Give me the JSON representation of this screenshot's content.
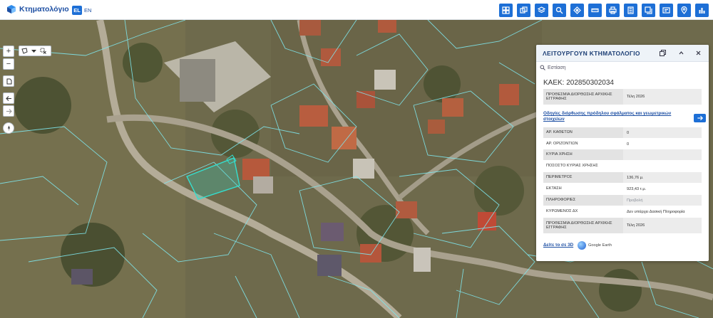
{
  "app": {
    "logo_text": "Κτηματολόγιο",
    "lang_el": "EL",
    "lang_en": "EN"
  },
  "toolbar": {
    "icons": [
      "layout-grid-icon",
      "layers-copy-icon",
      "layers-icon",
      "search-icon",
      "target-icon",
      "ruler-icon",
      "print-icon",
      "calculator-icon",
      "stack-icon",
      "certificate-icon",
      "location-pin-icon",
      "chart-icon"
    ],
    "accent": "#1d6fd6"
  },
  "map_controls": {
    "zoom_in": "+",
    "zoom_out": "−"
  },
  "panel": {
    "title": "ΛΕΙΤΟΥΡΓΟΥΝ ΚΤΗΜΑΤΟΛΟΓΙΟ",
    "focus_label": "Εστίαση",
    "kaek": "ΚΑΕΚ: 202850302034",
    "deadline": {
      "key": "ΠΡΟΘΕΣΜΙΑ ΔΙΟΡΘΩΣΗΣ ΑΡΧΙΚΗΣ ΕΓΓΡΑΦΗΣ",
      "value": "Τέλη 2026"
    },
    "guide_link": "Οδηγίες διόρθωσης πρόδηλου σφάλματος και γεωμετρικών στοιχείων",
    "rows": [
      {
        "key": "ΑΡ. ΚΑΘΕΤΩΝ",
        "value": "0"
      },
      {
        "key": "ΑΡ. ΟΡΙΖΟΝΤΙΩΝ",
        "value": "0"
      },
      {
        "key": "ΚΥΡΙΑ ΧΡΗΣΗ",
        "value": ""
      },
      {
        "key": "ΠΟΣΟΣΤΟ ΚΥΡΙΑΣ ΧΡΗΣΗΣ",
        "value": ""
      },
      {
        "key": "ΠΕΡΙΜΕΤΡΟΣ",
        "value": "136,76 μ."
      },
      {
        "key": "ΕΚΤΑΣΗ",
        "value": "923,43 τ.μ."
      },
      {
        "key": "ΠΛΗΡΟΦΟΡΙΕΣ",
        "value": "Προβολή"
      },
      {
        "key": "ΚΥΡΩΜΕΝΟΣ ΔΧ",
        "value": "Δεν υπάρχει Δασική Πληροφορία"
      },
      {
        "key": "ΠΡΟΘΕΣΜΙΑ ΔΙΟΡΘΩΣΗΣ ΑΡΧΙΚΗΣ ΕΓΓΡΑΦΗΣ",
        "value": "Τέλη 2026"
      }
    ],
    "view3d": "Δείτε το σε 3D",
    "google_earth": "Google Earth"
  }
}
